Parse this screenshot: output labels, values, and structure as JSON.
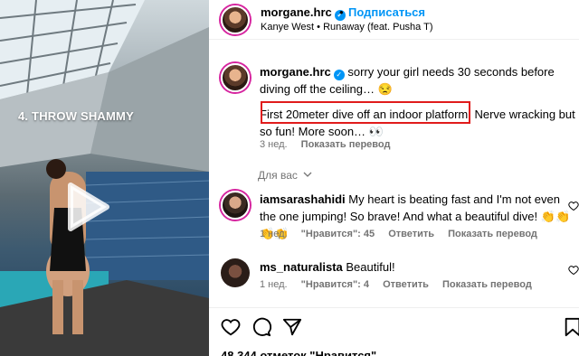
{
  "video": {
    "overlay_text": "4. THROW SHAMMY"
  },
  "post": {
    "username": "morgane.hrc",
    "follow_label": "Подписаться",
    "dot": "•",
    "song": "Kanye West • Runaway (feat. Pusha T)"
  },
  "caption": {
    "username": "morgane.hrc",
    "line1": "sorry your girl needs 30 seconds before diving off the ceiling… 😒",
    "line2": "First 20meter dive off an indoor platform. Nerve wracking but so fun! More soon… 👀",
    "time": "3 нед.",
    "translate": "Показать перевод"
  },
  "for_you_label": "Для вас",
  "comments": [
    {
      "username": "iamsarashahidi",
      "text": "My heart is beating fast and I'm not even the one jumping! So brave! And what a beautiful dive! 👏👏👏👏",
      "time": "1 нед.",
      "likes": "\"Нравится\": 45",
      "reply": "Ответить",
      "translate": "Показать перевод"
    },
    {
      "username": "ms_naturalista",
      "text": "Beautiful!",
      "time": "1 нед.",
      "likes": "\"Нравится\": 4",
      "reply": "Ответить",
      "translate": "Показать перевод"
    }
  ],
  "likes_count": "48 344 отметок \"Нравится\"",
  "icons": {
    "verified": "verified-badge",
    "like": "heart-icon",
    "comment": "comment-icon",
    "share": "share-icon",
    "save": "bookmark-icon",
    "play": "play-icon",
    "chevron": "chevron-down-icon"
  },
  "colors": {
    "accent": "#0095f6",
    "highlight": "#e01b1b",
    "muted": "#737373"
  }
}
